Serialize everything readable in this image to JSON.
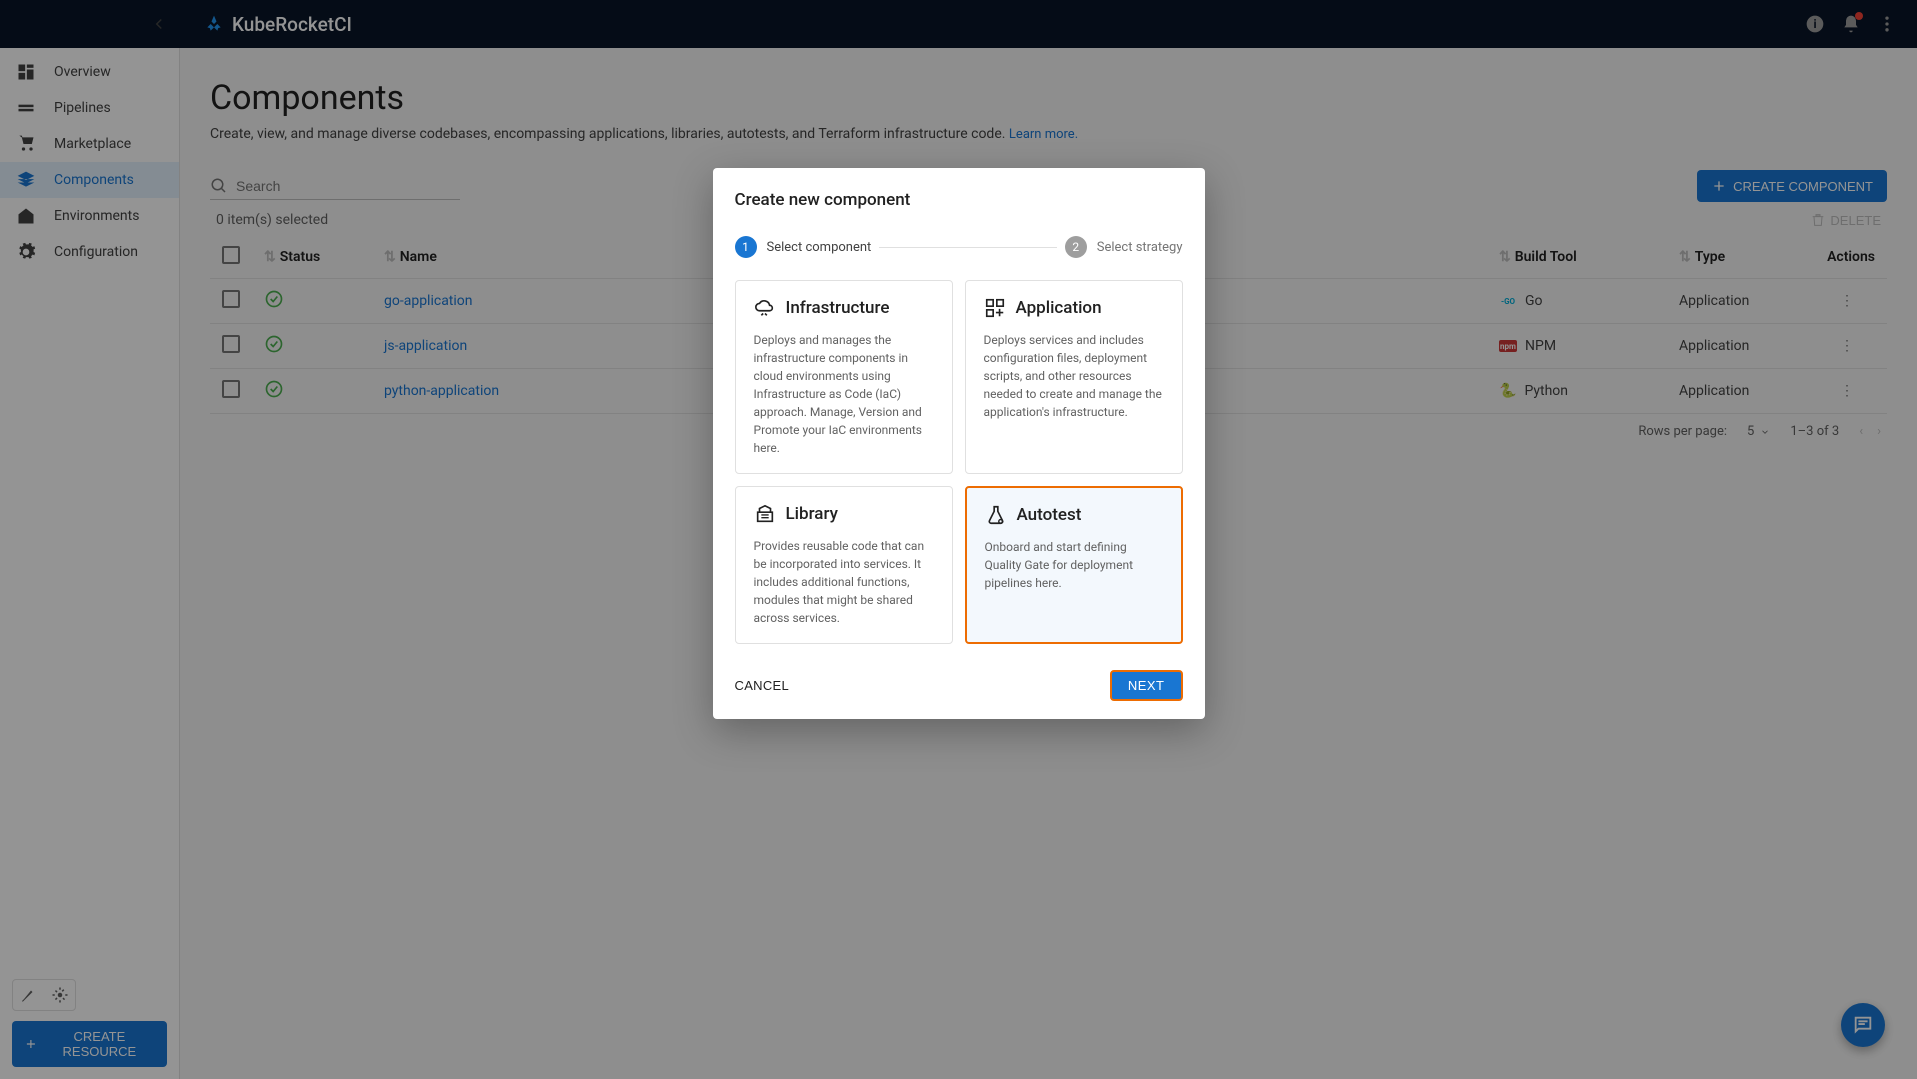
{
  "brand": "KubeRocketCI",
  "sidebar": {
    "items": [
      {
        "label": "Overview"
      },
      {
        "label": "Pipelines"
      },
      {
        "label": "Marketplace"
      },
      {
        "label": "Components"
      },
      {
        "label": "Environments"
      },
      {
        "label": "Configuration"
      }
    ],
    "create_resource": "CREATE RESOURCE"
  },
  "page": {
    "title": "Components",
    "description": "Create, view, and manage diverse codebases, encompassing applications, libraries, autotests, and Terraform infrastructure code. ",
    "learn_more": "Learn more."
  },
  "toolbar": {
    "search_placeholder": "Search",
    "create_component": "CREATE COMPONENT"
  },
  "selection": {
    "count": "0 item(s) selected",
    "delete": "DELETE"
  },
  "table": {
    "headers": {
      "status": "Status",
      "name": "Name",
      "buildtool": "Build Tool",
      "type": "Type",
      "actions": "Actions"
    },
    "rows": [
      {
        "name": "go-application",
        "buildtool": "Go",
        "type": "Application"
      },
      {
        "name": "js-application",
        "buildtool": "NPM",
        "type": "Application"
      },
      {
        "name": "python-application",
        "buildtool": "Python",
        "type": "Application"
      }
    ]
  },
  "pagination": {
    "rows_label": "Rows per page:",
    "rows_value": "5",
    "range": "1–3 of 3"
  },
  "dialog": {
    "title": "Create new component",
    "step1": "Select component",
    "step2": "Select strategy",
    "cards": {
      "infrastructure": {
        "title": "Infrastructure",
        "desc": "Deploys and manages the infrastructure components in cloud environments using Infrastructure as Code (IaC) approach. Manage, Version and Promote your IaC environments here."
      },
      "application": {
        "title": "Application",
        "desc": "Deploys services and includes configuration files, deployment scripts, and other resources needed to create and manage the application's infrastructure."
      },
      "library": {
        "title": "Library",
        "desc": "Provides reusable code that can be incorporated into services. It includes additional functions, modules that might be shared across services."
      },
      "autotest": {
        "title": "Autotest",
        "desc": "Onboard and start defining Quality Gate for deployment pipelines here."
      }
    },
    "cancel": "CANCEL",
    "next": "NEXT"
  }
}
